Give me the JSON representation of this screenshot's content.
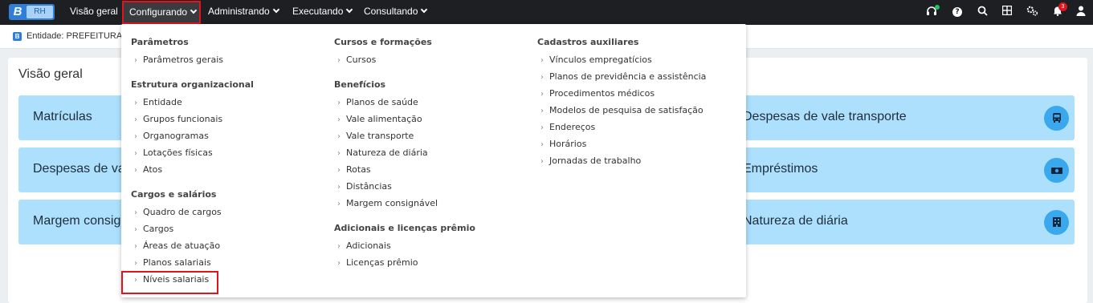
{
  "app": {
    "logo_letter": "B",
    "logo_suffix": "RH"
  },
  "nav": {
    "visao_geral": "Visão geral",
    "configurando": "Configurando",
    "administrando": "Administrando",
    "executando": "Executando",
    "consultando": "Consultando"
  },
  "topbar_icons": [
    "headset-icon",
    "help-icon",
    "search-icon",
    "apps-grid-icon",
    "settings-icon",
    "bell-icon",
    "user-icon"
  ],
  "notifications": {
    "count": "3"
  },
  "entity": {
    "icon_letter": "B",
    "label": "Entidade: PREFEITURA D"
  },
  "main": {
    "title": "Visão geral",
    "cards_left": [
      "Matrículas",
      "Despesas de val",
      "Margem consign"
    ],
    "cards_right": [
      "Despesas de vale transporte",
      "Empréstimos",
      "Natureza de diária"
    ]
  },
  "dropdown": {
    "col1": {
      "parametros": {
        "title": "Parâmetros",
        "items": [
          "Parâmetros gerais"
        ]
      },
      "estrutura": {
        "title": "Estrutura organizacional",
        "items": [
          "Entidade",
          "Grupos funcionais",
          "Organogramas",
          "Lotações físicas",
          "Atos"
        ]
      },
      "cargos": {
        "title": "Cargos e salários",
        "items": [
          "Quadro de cargos",
          "Cargos",
          "Áreas de atuação",
          "Planos salariais",
          "Níveis salariais"
        ]
      }
    },
    "col2": {
      "cursos": {
        "title": "Cursos e formações",
        "items": [
          "Cursos"
        ]
      },
      "beneficios": {
        "title": "Benefícios",
        "items": [
          "Planos de saúde",
          "Vale alimentação",
          "Vale transporte",
          "Natureza de diária",
          "Rotas",
          "Distâncias",
          "Margem consignável"
        ]
      },
      "adicionais": {
        "title": "Adicionais e licenças prêmio",
        "items": [
          "Adicionais",
          "Licenças prêmio"
        ]
      }
    },
    "col3": {
      "cadastros": {
        "title": "Cadastros auxiliares",
        "items": [
          "Vínculos empregatícios",
          "Planos de previdência e assistência",
          "Procedimentos médicos",
          "Modelos de pesquisa de satisfação",
          "Endereços",
          "Horários",
          "Jornadas de trabalho"
        ]
      }
    }
  },
  "colors": {
    "topbar": "#1e1f22",
    "card_bg": "#ace0fd",
    "card_icon": "#3aa8ec",
    "highlight": "#e0141c",
    "brand": "#2f7fd8"
  }
}
